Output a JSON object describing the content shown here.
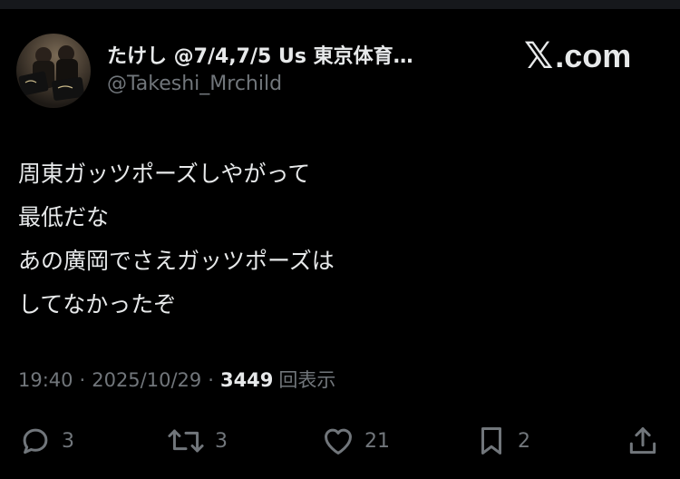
{
  "author": {
    "display_name": "たけし @7/4,7/5 Us 東京体育…",
    "handle": "@Takeshi_Mrchild"
  },
  "brand": {
    "x_glyph": "𝕏",
    "domain": ".com"
  },
  "tweet": {
    "lines": [
      "周東ガッツポーズしやがって",
      "最低だな",
      "あの廣岡でさえガッツポーズは",
      "してなかったぞ"
    ]
  },
  "meta": {
    "time": "19:40",
    "separator": "·",
    "date": "2025/10/29",
    "views_count": "3449",
    "views_label": "回表示"
  },
  "actions": {
    "replies": "3",
    "reposts": "3",
    "likes": "21",
    "bookmarks": "2"
  },
  "colors": {
    "background": "#000000",
    "text": "#e7e9ea",
    "secondary": "#71767b"
  }
}
